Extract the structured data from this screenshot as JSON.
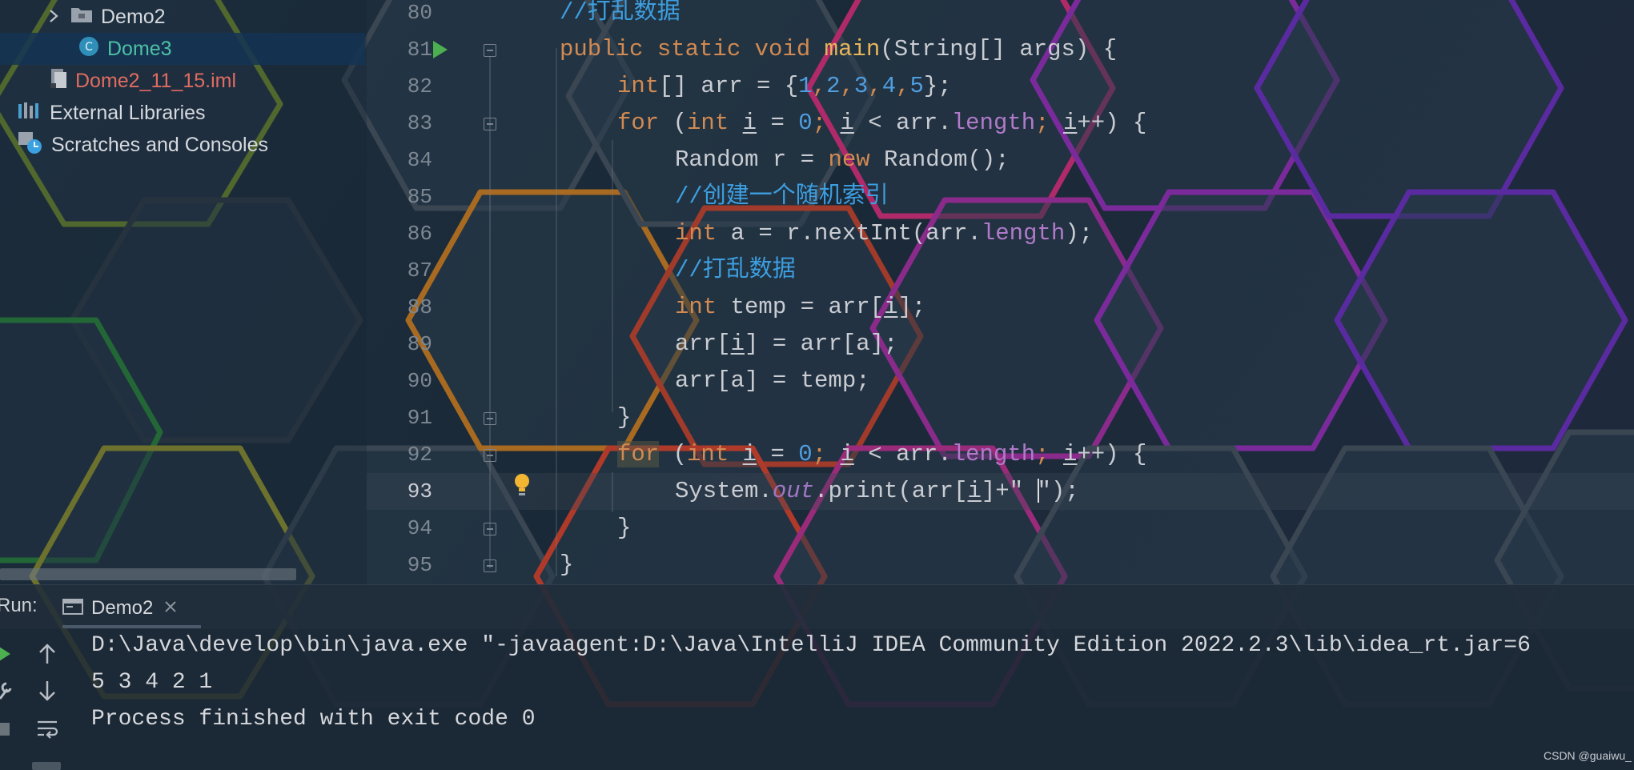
{
  "project_tree": {
    "items": [
      {
        "label": "Demo2",
        "icon": "folder-icon",
        "color": "#d6d9de"
      },
      {
        "label": "Dome3",
        "icon": "java-class-icon",
        "color": "#4ec0a5"
      },
      {
        "label": "Dome2_11_15.iml",
        "icon": "iml-file-icon",
        "color": "#e06c60"
      },
      {
        "label": "External Libraries",
        "icon": "library-icon",
        "color": "#d6d9de"
      },
      {
        "label": "Scratches and Consoles",
        "icon": "scratches-icon",
        "color": "#d6d9de"
      }
    ]
  },
  "editor": {
    "line_numbers": [
      "80",
      "81",
      "82",
      "83",
      "84",
      "85",
      "86",
      "87",
      "88",
      "89",
      "90",
      "91",
      "92",
      "93",
      "94",
      "95"
    ],
    "lines": {
      "l80": "//打乱数据",
      "l81_kw": "public static void",
      "l81_fn": "main",
      "l81_rest": "(String[] args) {",
      "l82_kw": "int",
      "l82_a": "[] arr = {",
      "n1": "1",
      "n2": "2",
      "n3": "3",
      "n4": "4",
      "n5": "5",
      "l82_end": "};",
      "for": "for",
      "int": "int",
      "var_i": "i",
      "zero": "0",
      "length": "length",
      "l84_a": "Random r = ",
      "new": "new",
      "l84_b": " Random();",
      "l85": "//创建一个随机索引",
      "l86_b": " a = r.nextInt(arr.",
      "l86_c": ");",
      "l87": "//打乱数据",
      "l88_b": " temp = arr[",
      "l88_c": "];",
      "l89_a": "arr[",
      "l89_b": "] = arr[a];",
      "l90": "arr[a] = temp;",
      "close_brace": "}",
      "l93_a": "System.",
      "l93_out": "out",
      "l93_b": ".print(arr[",
      "l93_c": "]+\" ",
      "l93_d": "\");"
    }
  },
  "run_panel": {
    "run_label": "Run:",
    "tab_label": "Demo2",
    "console": [
      "D:\\Java\\develop\\bin\\java.exe \"-javaagent:D:\\Java\\IntelliJ IDEA Community Edition 2022.2.3\\lib\\idea_rt.jar=6",
      "5 3 4 2 1",
      "Process finished with exit code 0"
    ]
  },
  "watermark": "CSDN @guaiwu_"
}
